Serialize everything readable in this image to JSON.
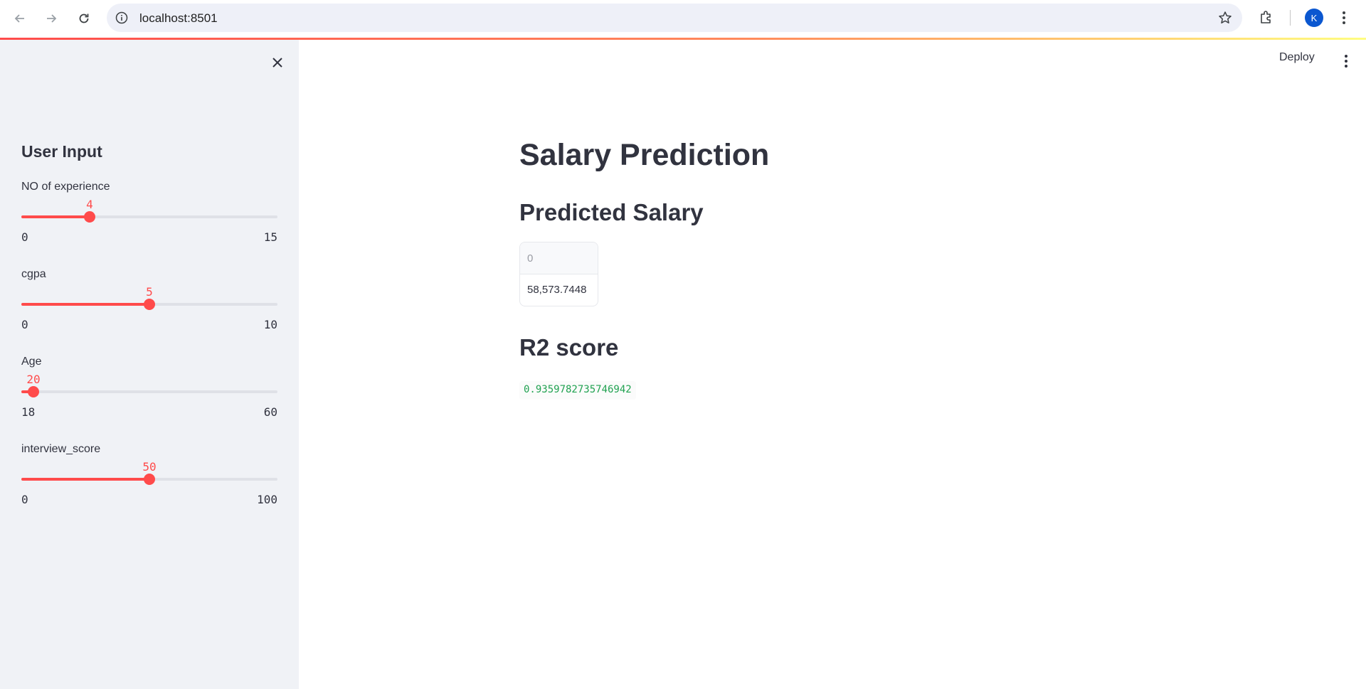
{
  "browser": {
    "url": "localhost:8501",
    "profile_initial": "K"
  },
  "app": {
    "deploy_label": "Deploy",
    "title": "Salary Prediction",
    "predicted_heading": "Predicted Salary",
    "table": {
      "column_header": "0",
      "value": "58,573.7448"
    },
    "r2_heading": "R2 score",
    "r2_value": "0.9359782735746942"
  },
  "sidebar": {
    "title": "User Input",
    "sliders": [
      {
        "label": "NO of experience",
        "value": "4",
        "min": "0",
        "max": "15",
        "fraction": 0.2667
      },
      {
        "label": "cgpa",
        "value": "5",
        "min": "0",
        "max": "10",
        "fraction": 0.5
      },
      {
        "label": "Age",
        "value": "20",
        "min": "18",
        "max": "60",
        "fraction": 0.0476
      },
      {
        "label": "interview_score",
        "value": "50",
        "min": "0",
        "max": "100",
        "fraction": 0.5
      }
    ]
  },
  "colors": {
    "accent": "#ff4b4b",
    "sidebar_bg": "#f0f2f6",
    "code_green": "#21a251"
  },
  "icons": [
    "back-arrow-icon",
    "forward-arrow-icon",
    "reload-icon",
    "info-icon",
    "star-icon",
    "extensions-icon",
    "kebab-menu-icon",
    "close-icon"
  ]
}
